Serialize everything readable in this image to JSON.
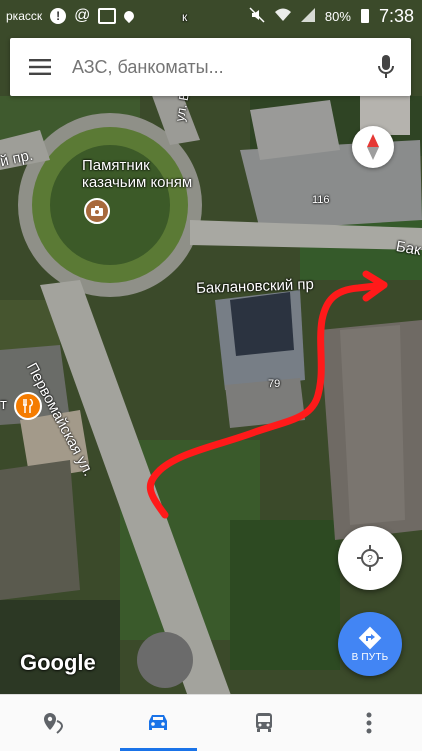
{
  "status_bar": {
    "left_text": "ркасск",
    "battery": "80%",
    "time": "7:38"
  },
  "search": {
    "placeholder": "АЗС, банкоматы..."
  },
  "map": {
    "labels": {
      "monument_line1": "Памятник",
      "monument_line2": "казачьим коням",
      "street_baklanovsky": "Баклановский пр",
      "street_pervomayskaya": "Первомайская ул.",
      "street_right_edge": "Бак",
      "street_left_edge": "й пр.",
      "street_top": "ул. Б",
      "street_top_right": "к",
      "house_116": "116",
      "house_79": "79",
      "restaurant_letter": "т"
    },
    "route_color": "#ff1a1a",
    "logo": "Google"
  },
  "buttons": {
    "route_label": "В ПУТЬ"
  },
  "bottom_nav": {
    "items": [
      {
        "name": "explore",
        "active": false
      },
      {
        "name": "driving",
        "active": true
      },
      {
        "name": "transit",
        "active": false
      },
      {
        "name": "more",
        "active": false
      }
    ]
  },
  "colors": {
    "accent": "#4285f4",
    "active_tab": "#1a73e8"
  }
}
